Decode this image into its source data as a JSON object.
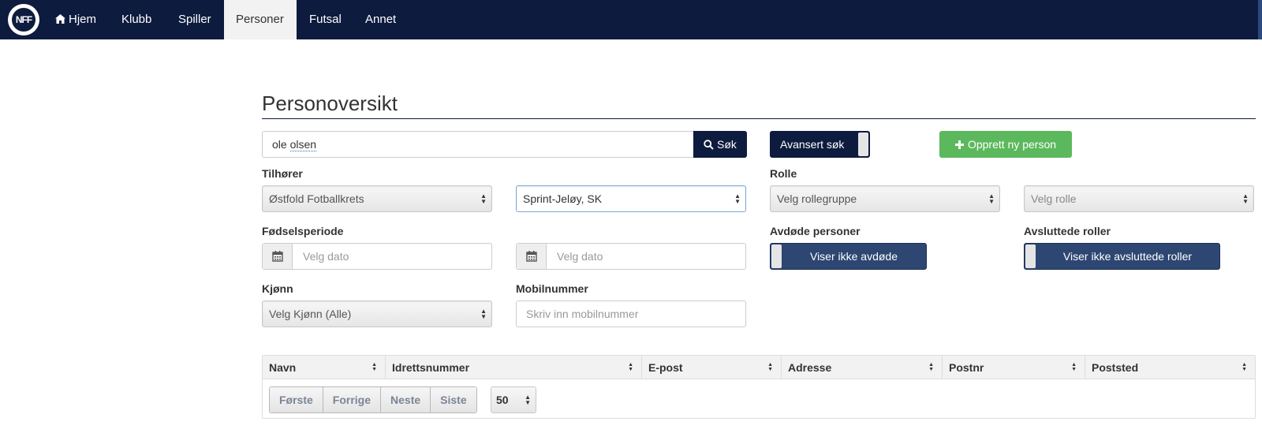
{
  "nav": {
    "logo_text": "NFF",
    "items": [
      {
        "label": "Hjem",
        "icon": "home-icon"
      },
      {
        "label": "Klubb"
      },
      {
        "label": "Spiller"
      },
      {
        "label": "Personer",
        "active": true
      },
      {
        "label": "Futsal"
      },
      {
        "label": "Annet"
      }
    ]
  },
  "page": {
    "title": "Personoversikt"
  },
  "search": {
    "value_prefix": "ole ",
    "value_underlined": "olsen",
    "button_label": "Søk",
    "advanced_label": "Avansert søk",
    "create_label": "Opprett ny person"
  },
  "filters": {
    "belongs_label": "Tilhører",
    "district_value": "Østfold Fotballkrets",
    "club_value": "Sprint-Jeløy, SK",
    "role_label": "Rolle",
    "rolegroup_placeholder": "Velg rollegruppe",
    "role_placeholder": "Velg rolle",
    "birth_label": "Fødselsperiode",
    "date_from_placeholder": "Velg dato",
    "date_to_placeholder": "Velg dato",
    "deceased_label": "Avdøde personer",
    "deceased_toggle": "Viser ikke avdøde",
    "ended_label": "Avsluttede roller",
    "ended_toggle": "Viser ikke avsluttede roller",
    "gender_label": "Kjønn",
    "gender_value": "Velg Kjønn (Alle)",
    "mobile_label": "Mobilnummer",
    "mobile_placeholder": "Skriv inn mobilnummer"
  },
  "table": {
    "columns": [
      "Navn",
      "Idrettsnummer",
      "E-post",
      "Adresse",
      "Postnr",
      "Poststed"
    ],
    "pager": [
      "Første",
      "Forrige",
      "Neste",
      "Siste"
    ],
    "page_size": "50"
  },
  "colors": {
    "navbar": "#0d1b3e",
    "create": "#5cb85c",
    "toggle": "#2d4672"
  }
}
